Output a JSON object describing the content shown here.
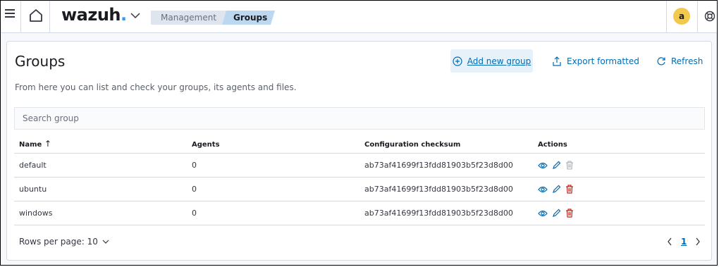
{
  "header": {
    "logo_text": "wazuh",
    "logo_dot": ".",
    "breadcrumbs": [
      {
        "label": "Management"
      },
      {
        "label": "Groups"
      }
    ],
    "avatar_letter": "a"
  },
  "page": {
    "title": "Groups",
    "subtitle": "From here you can list and check your groups, its agents and files.",
    "buttons": {
      "add": "Add new group",
      "export": "Export formatted",
      "refresh": "Refresh"
    },
    "search": {
      "placeholder": "Search group",
      "value": ""
    }
  },
  "table": {
    "columns": [
      "Name",
      "Agents",
      "Configuration checksum",
      "Actions"
    ],
    "sort_indicator": "↑",
    "rows": [
      {
        "name": "default",
        "agents": "0",
        "checksum": "ab73af41699f13fdd81903b5f23d8d00"
      },
      {
        "name": "ubuntu",
        "agents": "0",
        "checksum": "ab73af41699f13fdd81903b5f23d8d00"
      },
      {
        "name": "windows",
        "agents": "0",
        "checksum": "ab73af41699f13fdd81903b5f23d8d00"
      }
    ]
  },
  "pagination": {
    "rows_per_page_label": "Rows per page: 10",
    "current_page": "1"
  },
  "colors": {
    "accent": "#006bb4",
    "delete_active": "#bd271e",
    "delete_disabled": "#a6abb3",
    "avatar": "#f2c94c"
  },
  "icons": [
    "menu-icon",
    "home-icon",
    "chevron-down-icon",
    "help-icon",
    "plus-circle-icon",
    "export-icon",
    "refresh-icon",
    "eye-icon",
    "pencil-icon",
    "trash-icon",
    "chevron-left-icon",
    "chevron-right-icon"
  ]
}
